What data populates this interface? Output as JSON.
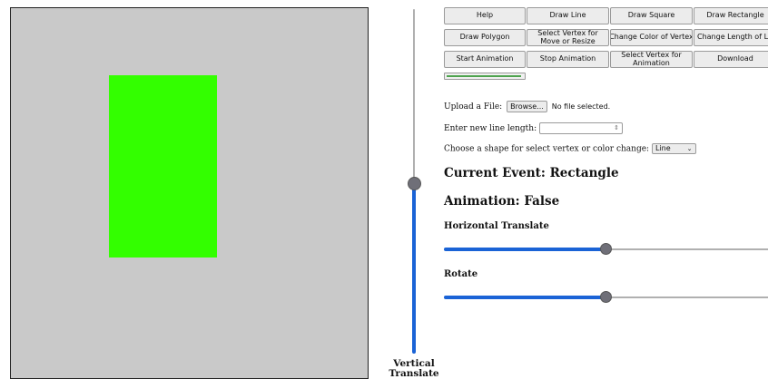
{
  "colors": {
    "canvas_bg": "#c9c9c9",
    "shape_fill": "#33ff00",
    "slider_accent": "#1a63d6"
  },
  "canvas": {
    "shape": {
      "type": "rectangle",
      "color": "#33ff00"
    }
  },
  "vertical_slider": {
    "label": "Vertical Translate",
    "value_fraction": 0.5
  },
  "toolbar": {
    "row1": [
      "Help",
      "Draw Line",
      "Draw Square",
      "Draw Rectangle"
    ],
    "row2": [
      "Draw Polygon",
      "Select Vertex for Move or Resize",
      "Change Color of Vertex",
      "Change Length of Line"
    ],
    "row3": [
      "Start Animation",
      "Stop Animation",
      "Select Vertex for Animation",
      "Download"
    ],
    "progress_fraction": 0.95
  },
  "upload": {
    "label": "Upload a File:",
    "button": "Browse...",
    "status": "No file selected."
  },
  "line_length": {
    "label": "Enter new line length:",
    "value": ""
  },
  "shape_select": {
    "label": "Choose a shape for select vertex or color change:",
    "selected": "Line"
  },
  "current_event": "Current Event: Rectangle",
  "animation": "Animation: False",
  "horizontal_translate": {
    "label": "Horizontal Translate",
    "value_fraction": 0.5
  },
  "rotate": {
    "label": "Rotate",
    "value_fraction": 0.5
  }
}
